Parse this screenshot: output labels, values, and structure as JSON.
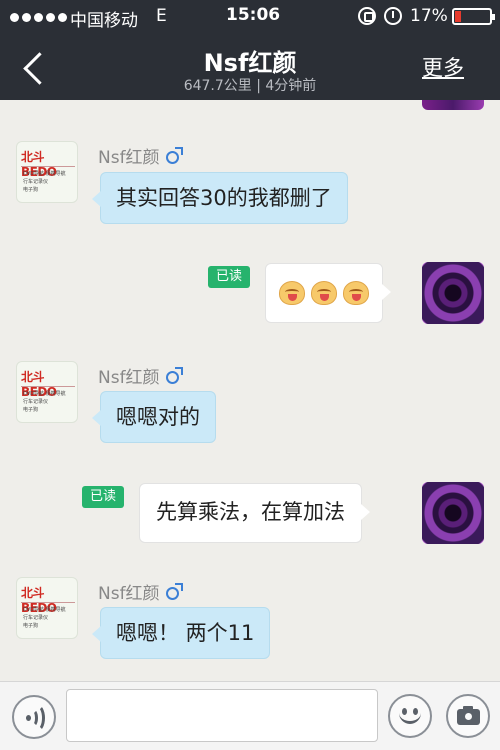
{
  "status_bar": {
    "carrier": "中国移动",
    "network": "E",
    "time": "15:06",
    "battery_text": "17%",
    "battery_level": 0.17,
    "icons": [
      "signal-dots-icon",
      "rotation-lock-icon",
      "alarm-icon",
      "battery-icon"
    ]
  },
  "nav": {
    "title": "Nsf红颜",
    "subtitle": "647.7公里 | 4分钟前",
    "more_label": "更多",
    "back_icon": "chevron-left-icon"
  },
  "contact": {
    "name": "Nsf红颜",
    "gender_icon": "male-icon",
    "avatar_brand": "北斗BEDO",
    "avatar_lines": [
      "DVD导航 便携导航",
      "行车记录仪",
      "电子狗"
    ]
  },
  "messages": [
    {
      "direction": "in",
      "sender": "Nsf红颜",
      "text": "其实回答30的我都删了"
    },
    {
      "direction": "out",
      "read_label": "已读",
      "emoji_count": 3
    },
    {
      "direction": "in",
      "sender": "Nsf红颜",
      "text": "嗯嗯对的"
    },
    {
      "direction": "out",
      "read_label": "已读",
      "text": "先算乘法，在算加法"
    },
    {
      "direction": "in",
      "sender": "Nsf红颜",
      "text": "嗯嗯！ 两个11"
    }
  ],
  "input_bar": {
    "placeholder": "",
    "voice_icon": "voice-icon",
    "emoji_icon": "smiley-icon",
    "camera_icon": "camera-icon"
  },
  "colors": {
    "header_bg": "#2b2f36",
    "incoming_bubble": "#cbe9f8",
    "outgoing_bubble": "#ffffff",
    "read_badge": "#26b36d",
    "chat_bg": "#efeeea"
  }
}
